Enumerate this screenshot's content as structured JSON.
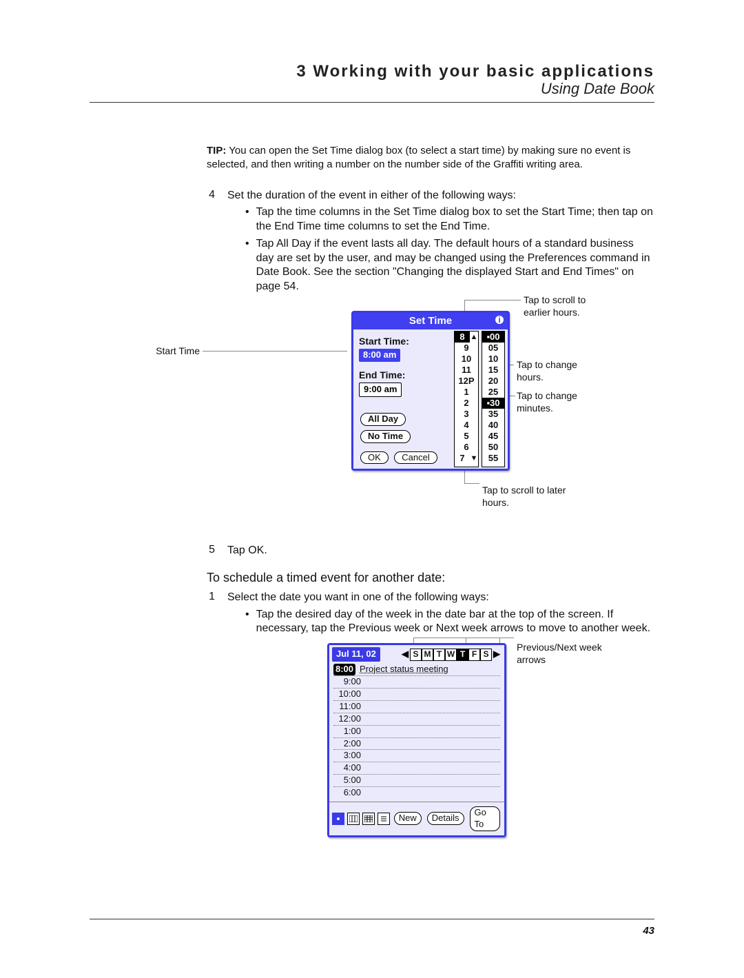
{
  "header": {
    "chapter": "3 Working with your basic applications",
    "section": "Using Date Book"
  },
  "tip": {
    "label": "TIP:",
    "text": "You can open the Set Time dialog box (to select a start time) by making sure no event is selected, and then writing a number on the number side of the Graffiti writing area."
  },
  "step4": {
    "num": "4",
    "lead": "Set the duration of the event in either of the following ways:",
    "b1": "Tap the time columns in the Set Time dialog box to set the Start Time; then tap on the End Time time columns to set the End Time.",
    "b2": "Tap All Day if the event lasts all day. The default hours of a standard business day are set by the user, and may be changed using the Preferences command in Date Book. See the section \"Changing the displayed Start and End Times\" on page 54."
  },
  "callouts": {
    "start_time": "Start Time",
    "scroll_earlier": "Tap to scroll to earlier hours.",
    "change_hours": "Tap to change hours.",
    "change_minutes": "Tap to change minutes.",
    "scroll_later": "Tap to scroll to later hours.",
    "prev_next": "Previous/Next week arrows"
  },
  "set_time": {
    "title": "Set Time",
    "start_label": "Start Time:",
    "start_value": "8:00 am",
    "end_label": "End Time:",
    "end_value": "9:00 am",
    "all_day": "All Day",
    "no_time": "No Time",
    "ok": "OK",
    "cancel": "Cancel",
    "hours": [
      "8",
      "9",
      "10",
      "11",
      "12P",
      "1",
      "2",
      "3",
      "4",
      "5",
      "6",
      "7"
    ],
    "minutes": [
      "00",
      "05",
      "10",
      "15",
      "20",
      "25",
      "30",
      "35",
      "40",
      "45",
      "50",
      "55"
    ],
    "hour_selected": "8",
    "minute_selected_top": "00",
    "minute_selected_mid": "30"
  },
  "step5": {
    "num": "5",
    "text": "Tap OK."
  },
  "subheading": "To schedule a timed event for another date:",
  "step1b": {
    "num": "1",
    "lead": "Select the date you want in one of the following ways:",
    "b1": "Tap the desired day of the week in the date bar at the top of the screen. If necessary, tap the Previous week or Next week arrows to move to another week."
  },
  "datebook": {
    "date": "Jul 11, 02",
    "days": [
      "S",
      "M",
      "T",
      "W",
      "T",
      "F",
      "S"
    ],
    "selected_index": 4,
    "rows": [
      {
        "time": "8:00",
        "event": "Project status meeting",
        "sel": true
      },
      {
        "time": "9:00"
      },
      {
        "time": "10:00"
      },
      {
        "time": "11:00"
      },
      {
        "time": "12:00"
      },
      {
        "time": "1:00"
      },
      {
        "time": "2:00"
      },
      {
        "time": "3:00"
      },
      {
        "time": "4:00"
      },
      {
        "time": "5:00"
      },
      {
        "time": "6:00"
      }
    ],
    "buttons": {
      "new": "New",
      "details": "Details",
      "goto": "Go To"
    }
  },
  "page_number": "43"
}
